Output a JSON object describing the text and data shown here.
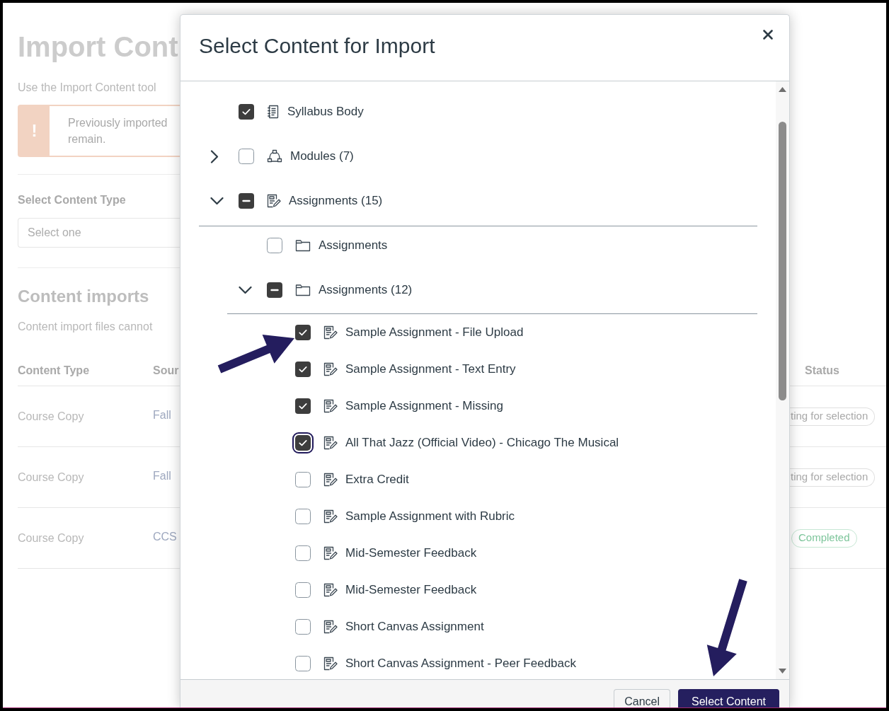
{
  "background_page": {
    "title": "Import Cont",
    "intro": "Use the Import Content tool",
    "alert": {
      "icon": "!",
      "lines": [
        "Previously imported",
        "remain."
      ]
    },
    "content_type": {
      "label": "Select Content Type",
      "placeholder": "Select one"
    },
    "imports": {
      "heading": "Content imports",
      "note": "Content import files cannot"
    },
    "table": {
      "columns": [
        "Content Type",
        "Sour",
        "Status"
      ],
      "rows": [
        {
          "content_type": "Course Copy",
          "source": "Fall",
          "status": {
            "text": "ting for selection",
            "kind": "waiting"
          }
        },
        {
          "content_type": "Course Copy",
          "source": "Fall",
          "status": {
            "text": "ting for selection",
            "kind": "waiting"
          }
        },
        {
          "content_type": "Course Copy",
          "source": "CCS",
          "status": {
            "text": "Completed",
            "kind": "completed"
          }
        }
      ]
    }
  },
  "dialog": {
    "title": "Select Content for Import",
    "tree": [
      {
        "label": "Syllabus Body",
        "kind": "syllabus",
        "checked": true,
        "indeterminate": false
      },
      {
        "label": "Modules (7)",
        "kind": "modules",
        "checked": false,
        "indeterminate": false,
        "expanded": false
      },
      {
        "label": "Assignments (15)",
        "kind": "assignments",
        "indeterminate": true,
        "expanded": true,
        "children": [
          {
            "label": "Assignments",
            "kind": "folder",
            "checked": false,
            "indeterminate": false
          },
          {
            "label": "Assignments (12)",
            "kind": "folder",
            "indeterminate": true,
            "expanded": true,
            "children": [
              {
                "label": "Sample Assignment - File Upload",
                "kind": "assignment",
                "checked": true,
                "focused": false
              },
              {
                "label": "Sample Assignment - Text Entry",
                "kind": "assignment",
                "checked": true,
                "focused": false
              },
              {
                "label": "Sample Assignment - Missing",
                "kind": "assignment",
                "checked": true,
                "focused": false
              },
              {
                "label": "All That Jazz (Official Video) - Chicago The Musical",
                "kind": "assignment",
                "checked": true,
                "focused": true
              },
              {
                "label": "Extra Credit",
                "kind": "assignment",
                "checked": false,
                "focused": false
              },
              {
                "label": "Sample Assignment with Rubric",
                "kind": "assignment",
                "checked": false,
                "focused": false
              },
              {
                "label": "Mid-Semester Feedback",
                "kind": "assignment",
                "checked": false,
                "focused": false
              },
              {
                "label": "Mid-Semester Feedback",
                "kind": "assignment",
                "checked": false,
                "focused": false
              },
              {
                "label": "Short Canvas Assignment",
                "kind": "assignment",
                "checked": false,
                "focused": false
              },
              {
                "label": "Short Canvas Assignment - Peer Feedback",
                "kind": "assignment",
                "checked": false,
                "focused": false
              }
            ]
          }
        ]
      }
    ],
    "buttons": [
      {
        "label": "Cancel",
        "kind": "cancel"
      },
      {
        "label": "Select Content",
        "kind": "submit"
      }
    ]
  }
}
